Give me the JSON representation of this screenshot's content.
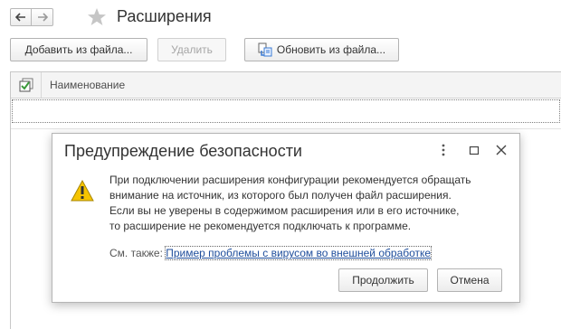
{
  "window": {
    "title": "Расширения"
  },
  "nav": {
    "back_icon": "arrow-left-icon",
    "forward_icon": "arrow-right-icon",
    "favorite_icon": "star-icon"
  },
  "toolbar": {
    "add_from_file": "Добавить из файла...",
    "delete": "Удалить",
    "update_from_file": "Обновить из файла..."
  },
  "grid": {
    "columns": [
      "Наименование"
    ],
    "rows": []
  },
  "dialog": {
    "title": "Предупреждение безопасности",
    "message_lines": [
      "При подключении расширения конфигурации рекомендуется обращать",
      "внимание на источник, из которого был получен файл расширения.",
      "Если вы не уверены в содержимом расширения или в его источнике,",
      "то расширение не рекомендуется подключать к программе."
    ],
    "see_also_label": "См. также:",
    "see_also_link": "Пример проблемы с вирусом во внешней обработке",
    "continue_label": "Продолжить",
    "cancel_label": "Отмена"
  },
  "colors": {
    "link": "#1f4e9c",
    "warning_yellow": "#f5c400",
    "check_green": "#3a9a3a"
  }
}
